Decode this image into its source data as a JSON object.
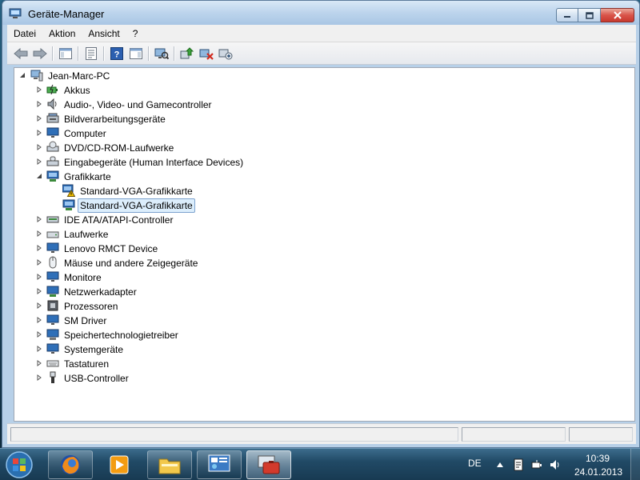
{
  "window": {
    "title": "Geräte-Manager"
  },
  "menubar": {
    "items": [
      "Datei",
      "Aktion",
      "Ansicht",
      "?"
    ]
  },
  "toolbar": {
    "buttons": [
      "back-icon",
      "forward-icon",
      "console-tree-icon",
      "properties-icon",
      "help-icon",
      "action-pane-icon",
      "scan-hardware-icon",
      "update-driver-icon",
      "disable-device-icon",
      "uninstall-device-icon"
    ]
  },
  "tree": {
    "root": "Jean-Marc-PC",
    "categories": [
      {
        "label": "Akkus",
        "expanded": false
      },
      {
        "label": "Audio-, Video- und Gamecontroller",
        "expanded": false
      },
      {
        "label": "Bildverarbeitungsgeräte",
        "expanded": false
      },
      {
        "label": "Computer",
        "expanded": false
      },
      {
        "label": "DVD/CD-ROM-Laufwerke",
        "expanded": false
      },
      {
        "label": "Eingabegeräte (Human Interface Devices)",
        "expanded": false
      },
      {
        "label": "Grafikkarte",
        "expanded": true
      },
      {
        "label": "IDE ATA/ATAPI-Controller",
        "expanded": false
      },
      {
        "label": "Laufwerke",
        "expanded": false
      },
      {
        "label": "Lenovo RMCT Device",
        "expanded": false
      },
      {
        "label": "Mäuse und andere Zeigegeräte",
        "expanded": false
      },
      {
        "label": "Monitore",
        "expanded": false
      },
      {
        "label": "Netzwerkadapter",
        "expanded": false
      },
      {
        "label": "Prozessoren",
        "expanded": false
      },
      {
        "label": "SM Driver",
        "expanded": false
      },
      {
        "label": "Speichertechnologietreiber",
        "expanded": false
      },
      {
        "label": "Systemgeräte",
        "expanded": false
      },
      {
        "label": "Tastaturen",
        "expanded": false
      },
      {
        "label": "USB-Controller",
        "expanded": false
      }
    ],
    "grafikkarte_children": [
      {
        "label": "Standard-VGA-Grafikkarte",
        "warning": true,
        "selected": false
      },
      {
        "label": "Standard-VGA-Grafikkarte",
        "warning": false,
        "selected": true
      }
    ]
  },
  "taskbar": {
    "apps": [
      "firefox-icon",
      "media-player-icon",
      "explorer-icon",
      "control-panel-icon",
      "device-manager-icon"
    ],
    "language": "DE",
    "time": "10:39",
    "date": "24.01.2013"
  },
  "colors": {
    "selection_bg": "#dceefc",
    "selection_border": "#7da2ce",
    "close_button": "#c7392e",
    "taskbar": "#214a66"
  }
}
